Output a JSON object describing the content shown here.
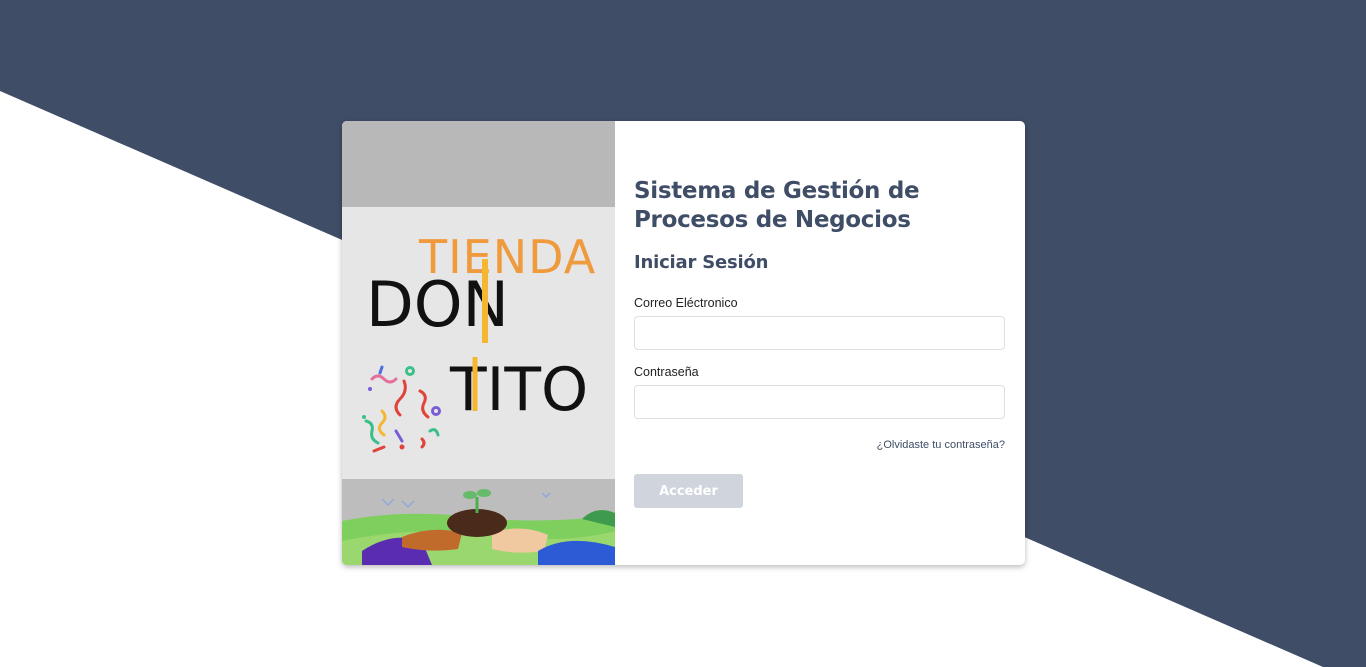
{
  "colors": {
    "background_dark": "#3f4d67",
    "background_light": "#ffffff",
    "title": "#3f4d67",
    "button_disabled": "#d0d5dd",
    "logo_orange": "#f09a3e",
    "logo_yellow": "#f5b731",
    "logo_black": "#111111"
  },
  "brand": {
    "logo_word_top": "TIENDA",
    "logo_word_middle": "DON",
    "logo_word_bottom": "TITO"
  },
  "login": {
    "system_title": "Sistema de Gestión de Procesos de Negocios",
    "heading": "Iniciar Sesión",
    "email_label": "Correo Eléctronico",
    "email_value": "",
    "password_label": "Contraseña",
    "password_value": "",
    "forgot_password": "¿Olvidaste tu contraseña?",
    "submit_label": "Acceder"
  }
}
